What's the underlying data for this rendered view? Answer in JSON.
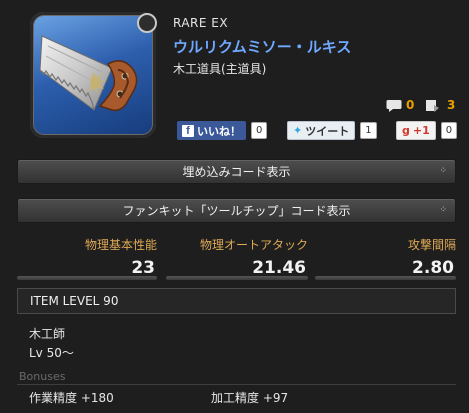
{
  "item": {
    "rarity": "RARE  EX",
    "name": "ウルリクムミソー・ルキス",
    "category": "木工道具(主道具)"
  },
  "counts": {
    "comments": "0",
    "lists": "3"
  },
  "social": {
    "facebook_label": "いいね！",
    "facebook_count": "0",
    "twitter_label": "ツイート",
    "twitter_count": "1",
    "gplus_label": "+1",
    "gplus_count": "0"
  },
  "buttons": {
    "embed": "埋め込みコード表示",
    "fankit": "ファンキット「ツールチップ」コード表示"
  },
  "stats": [
    {
      "label": "物理基本性能",
      "value": "23"
    },
    {
      "label": "物理オートアタック",
      "value": "21.46"
    },
    {
      "label": "攻撃間隔",
      "value": "2.80"
    }
  ],
  "item_level": "ITEM LEVEL 90",
  "job": "木工師",
  "level_req": "Lv 50～",
  "bonuses_heading": "Bonuses",
  "bonuses": [
    {
      "text": "作業精度 +180"
    },
    {
      "text": "加工精度 +97"
    }
  ],
  "colors": {
    "item_name": "#6fa8ff",
    "stat_label": "#e0aa55",
    "count": "#e8a000",
    "facebook": "#3b5998"
  }
}
